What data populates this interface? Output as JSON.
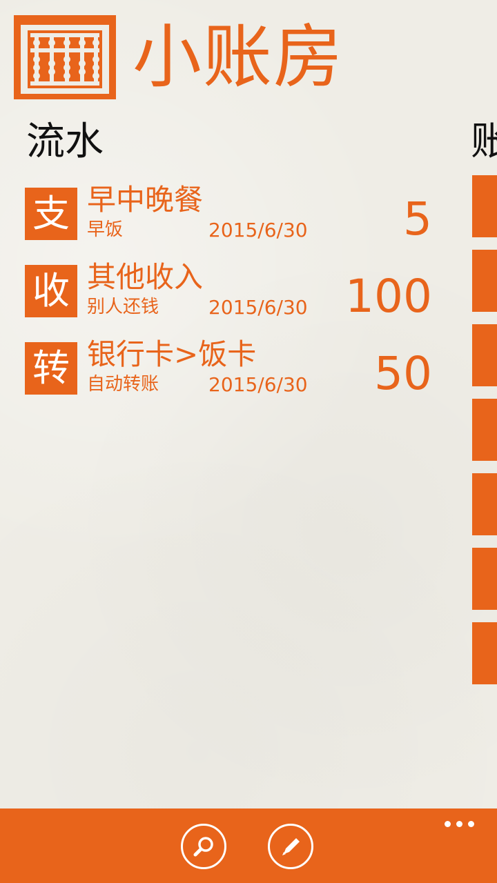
{
  "app": {
    "title": "小账房",
    "logo_icon": "abacus-icon"
  },
  "pivot": {
    "current": "流水",
    "next_peek": "账"
  },
  "colors": {
    "accent": "#e8641b",
    "background": "#efede6",
    "text_dark": "#111111"
  },
  "transactions": [
    {
      "badge": "支",
      "title": "早中晚餐",
      "note": "早饭",
      "date": "2015/6/30",
      "amount": "5"
    },
    {
      "badge": "收",
      "title": "其他收入",
      "note": "别人还钱",
      "date": "2015/6/30",
      "amount": "100"
    },
    {
      "badge": "转",
      "title": "银行卡>饭卡",
      "note": "自动转账",
      "date": "2015/6/30",
      "amount": "50"
    }
  ],
  "app_bar": {
    "buttons": [
      {
        "icon": "search-icon"
      },
      {
        "icon": "edit-icon"
      }
    ],
    "more_icon": "ellipsis-icon"
  }
}
